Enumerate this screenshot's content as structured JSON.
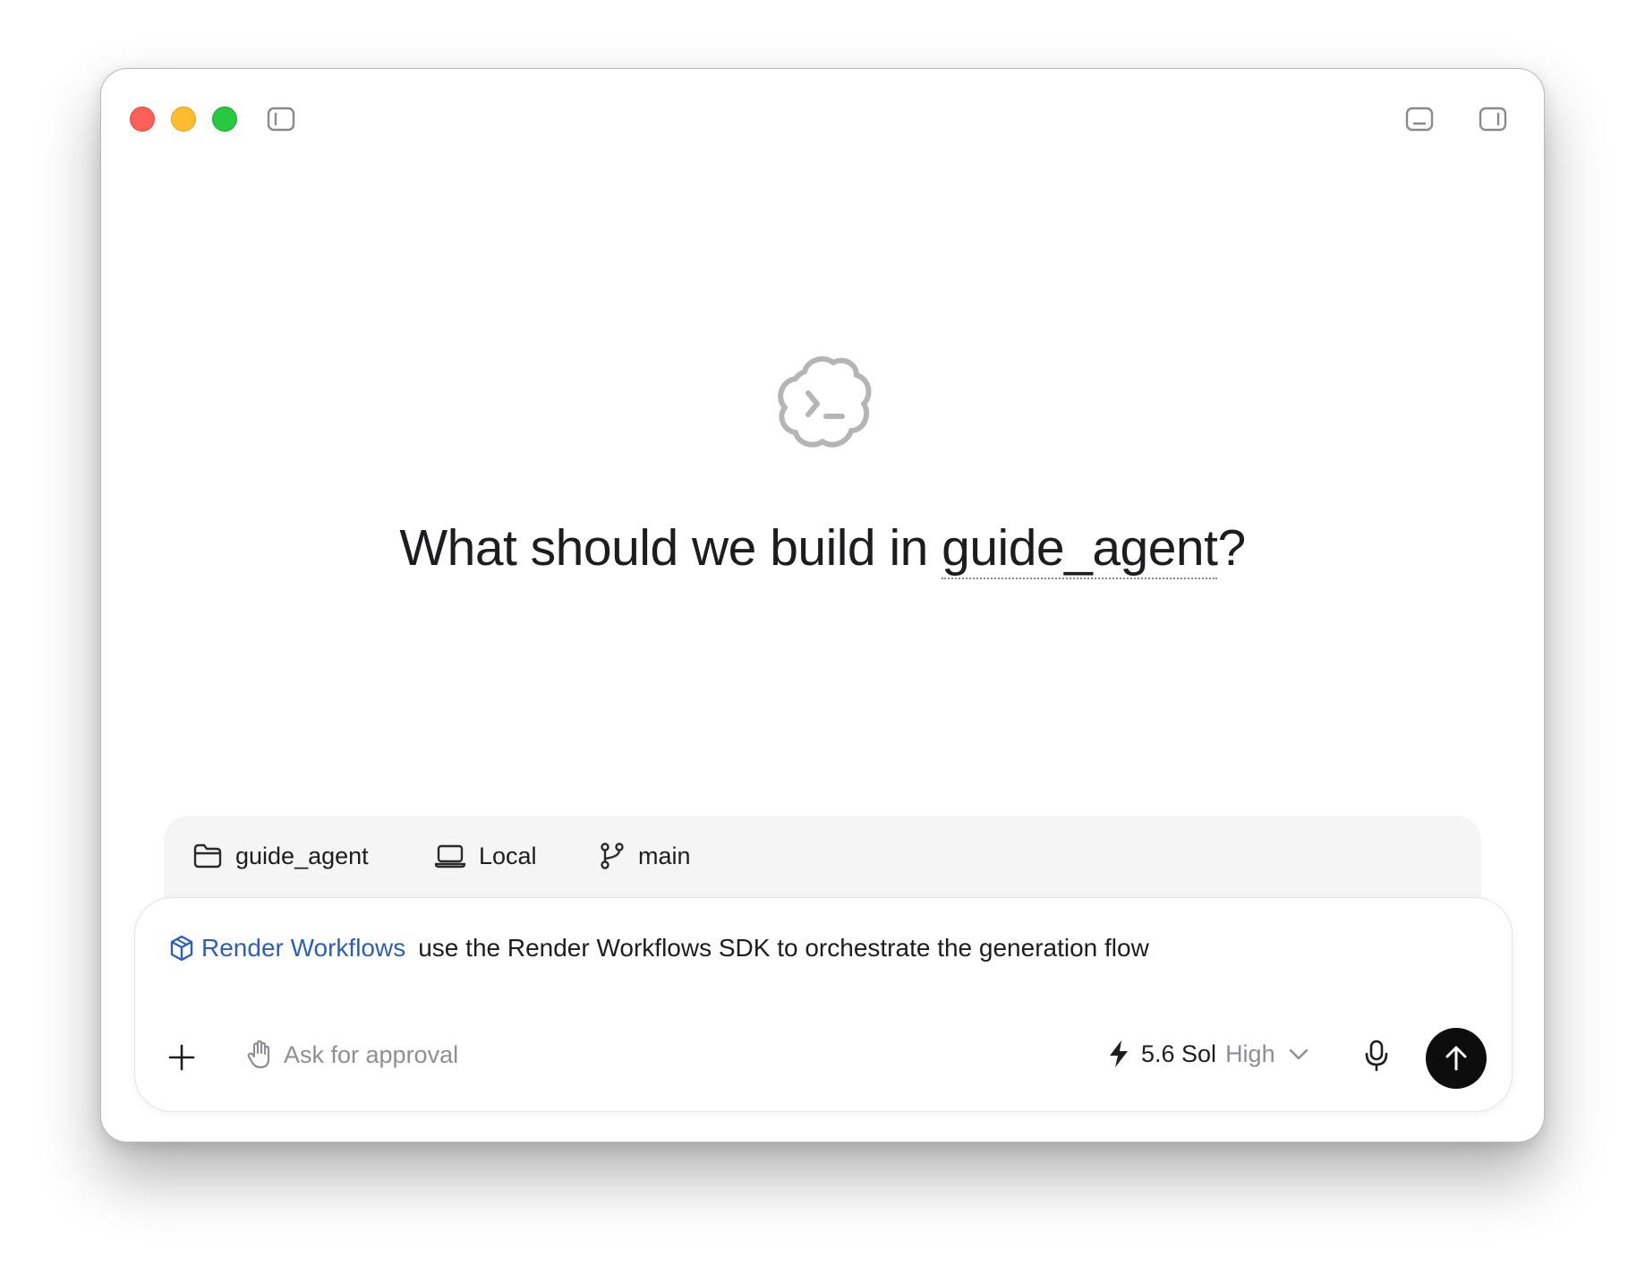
{
  "window": {
    "traffic_lights": [
      "close",
      "minimize",
      "zoom"
    ],
    "toolbar_icons": [
      "sidebar-left-icon",
      "bottom-panel-icon",
      "sidebar-right-icon"
    ]
  },
  "hero": {
    "logo_icon": "terminal-cloud-icon",
    "title_prefix": "What should we build in ",
    "repo_name": "guide_agent",
    "title_suffix": "?"
  },
  "context": {
    "folder": {
      "icon": "folder-icon",
      "label": "guide_agent"
    },
    "environment": {
      "icon": "laptop-icon",
      "label": "Local"
    },
    "branch": {
      "icon": "git-branch-icon",
      "label": "main"
    }
  },
  "composer": {
    "skill": {
      "icon": "cube-icon",
      "label": "Render Workflows",
      "color": "#2c5fb6"
    },
    "prompt_text": "use the Render Workflows SDK to orchestrate the generation flow",
    "add_icon": "plus-icon",
    "approval": {
      "icon": "hand-icon",
      "label": "Ask for approval"
    },
    "model": {
      "icon": "bolt-icon",
      "name": "5.6 Sol",
      "effort": "High",
      "dropdown_icon": "chevron-down-icon"
    },
    "mic_icon": "microphone-icon",
    "send_icon": "arrow-up-icon"
  },
  "colors": {
    "close": "#fe5f57",
    "minimize": "#febc2e",
    "zoom": "#28c840",
    "accent": "#2c5fb6",
    "send_button": "#0d0d0d"
  }
}
